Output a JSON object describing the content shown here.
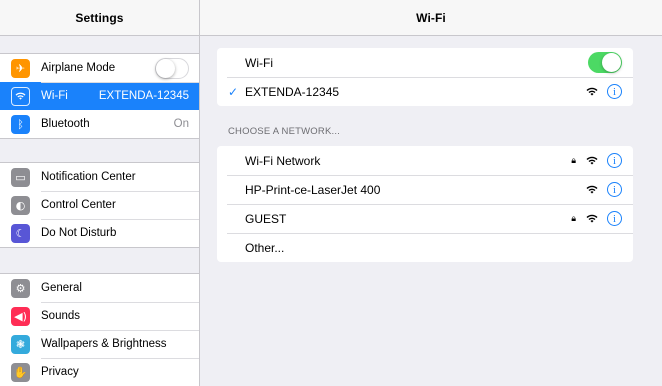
{
  "sidebar": {
    "title": "Settings",
    "groups": [
      [
        {
          "label": "Airplane Mode",
          "icon": "airplane-icon",
          "glyph": "✈",
          "color": "#ff9500",
          "toggle": "off"
        },
        {
          "label": "Wi-Fi",
          "icon": "wifi-icon",
          "glyph": "wifi",
          "color": "#1a82fb",
          "value": "EXTENDA-12345",
          "selected": true
        },
        {
          "label": "Bluetooth",
          "icon": "bluetooth-icon",
          "glyph": "ᛒ",
          "color": "#1a82fb",
          "value": "On"
        }
      ],
      [
        {
          "label": "Notification Center",
          "icon": "notification-center-icon",
          "glyph": "▭",
          "color": "#8e8e93"
        },
        {
          "label": "Control Center",
          "icon": "control-center-icon",
          "glyph": "◐",
          "color": "#8e8e93"
        },
        {
          "label": "Do Not Disturb",
          "icon": "moon-icon",
          "glyph": "☾",
          "color": "#5856d6"
        }
      ],
      [
        {
          "label": "General",
          "icon": "gear-icon",
          "glyph": "⚙",
          "color": "#8e8e93"
        },
        {
          "label": "Sounds",
          "icon": "speaker-icon",
          "glyph": "◀)",
          "color": "#ff2d55"
        },
        {
          "label": "Wallpapers & Brightness",
          "icon": "wallpaper-icon",
          "glyph": "❃",
          "color": "#34aadc"
        },
        {
          "label": "Privacy",
          "icon": "hand-icon",
          "glyph": "✋",
          "color": "#8e8e93"
        }
      ]
    ]
  },
  "main": {
    "title": "Wi-Fi",
    "wifi_toggle_label": "Wi-Fi",
    "wifi_enabled": true,
    "connected_network": "EXTENDA-12345",
    "section_header": "CHOOSE A NETWORK...",
    "networks": [
      {
        "name": "Wi-Fi Network",
        "locked": true
      },
      {
        "name": "HP-Print-ce-LaserJet 400",
        "locked": false
      },
      {
        "name": "GUEST",
        "locked": true
      }
    ],
    "other_label": "Other...",
    "accent_color": "#1a82fb",
    "toggle_on_color": "#4cd964"
  }
}
